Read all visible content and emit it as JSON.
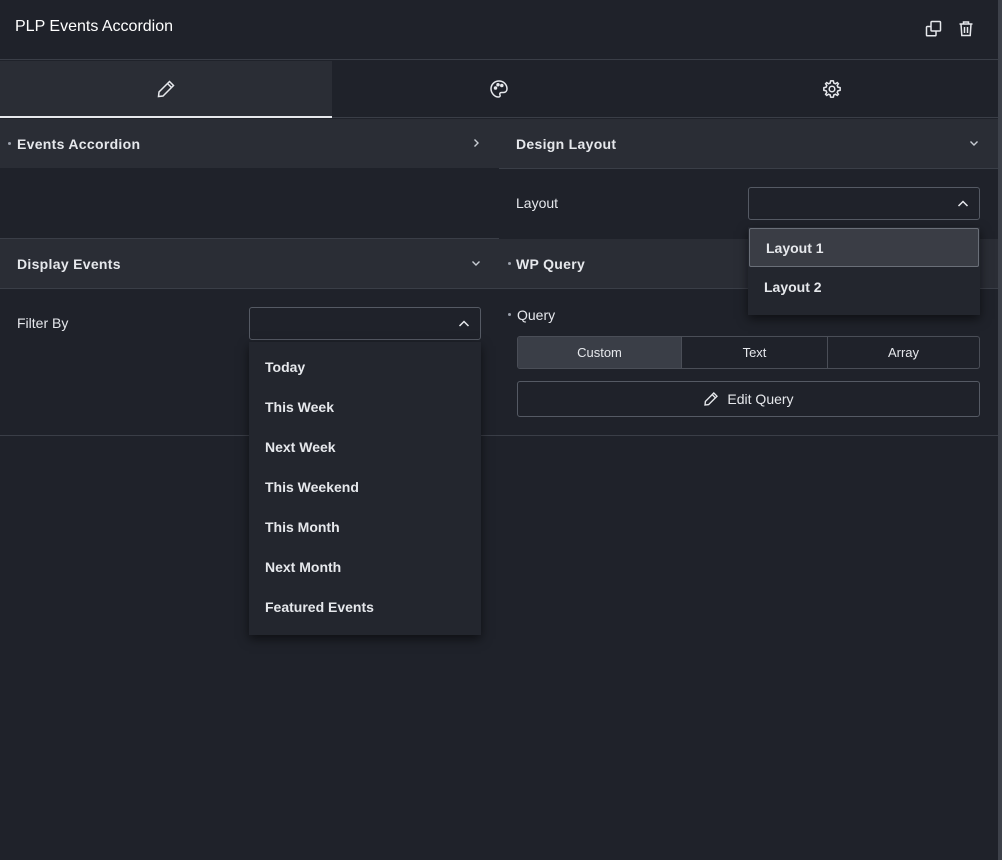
{
  "header": {
    "title": "PLP Events Accordion",
    "duplicate_icon": "duplicate-icon",
    "delete_icon": "trash-icon"
  },
  "tabs": [
    {
      "icon": "pencil-icon",
      "active": true
    },
    {
      "icon": "palette-icon",
      "active": false
    },
    {
      "icon": "gear-icon",
      "active": false
    }
  ],
  "sections": {
    "events_accordion": {
      "label": "Events Accordion",
      "chevron": "chevron-right-icon"
    },
    "design_layout": {
      "label": "Design Layout",
      "chevron": "chevron-down-icon"
    },
    "display_events": {
      "label": "Display Events",
      "chevron": "chevron-down-icon"
    },
    "wp_query": {
      "label": "WP Query"
    }
  },
  "layout_field": {
    "label": "Layout",
    "value": "",
    "options": [
      "Layout 1",
      "Layout 2"
    ],
    "highlighted": "Layout 1"
  },
  "filter_field": {
    "label": "Filter By",
    "value": "",
    "options": [
      "Today",
      "This Week",
      "Next Week",
      "This Weekend",
      "This Month",
      "Next Month",
      "Featured Events"
    ]
  },
  "query": {
    "label": "Query",
    "segments": [
      "Custom",
      "Text",
      "Array"
    ],
    "active_segment": "Custom",
    "edit_button": "Edit Query"
  },
  "colors": {
    "background": "#1f222a",
    "panel": "#2a2d35",
    "text": "#e6e8ec",
    "border": "#3a3e47"
  }
}
